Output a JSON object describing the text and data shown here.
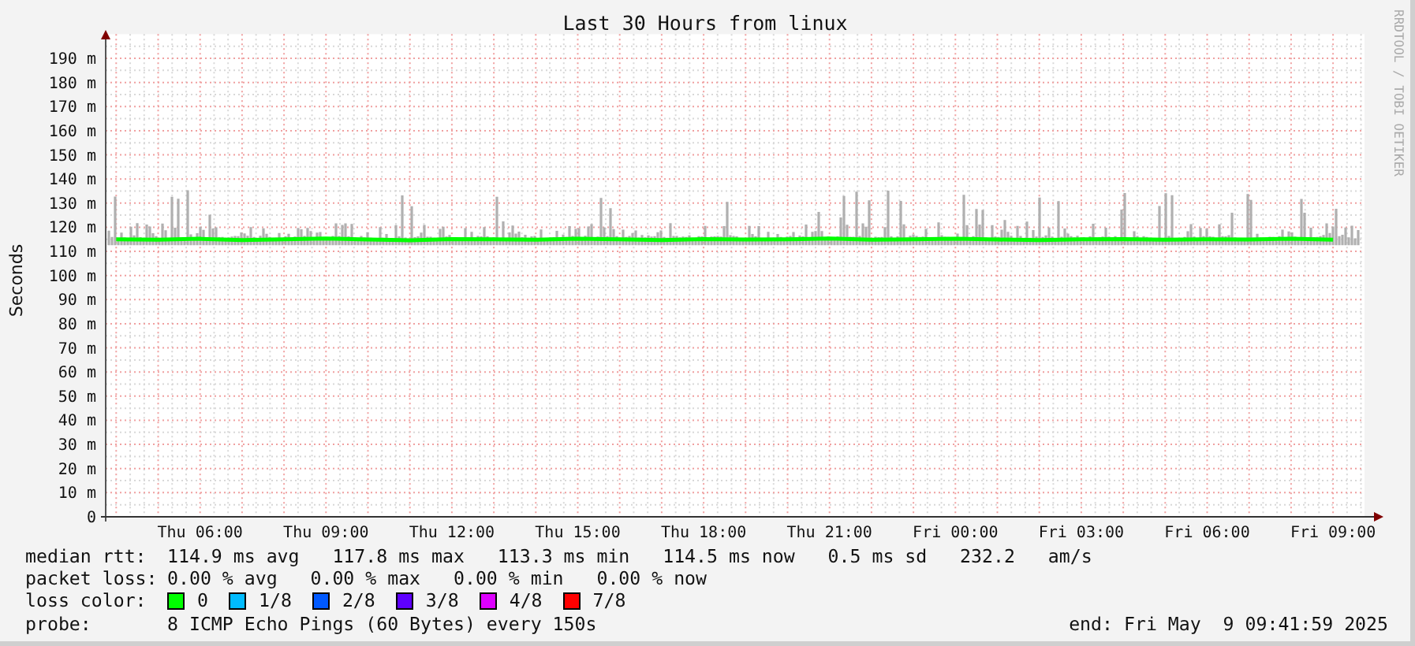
{
  "credit": "RRDTOOL / TOBI OETIKER",
  "chart": {
    "chart_data": {
      "type": "line",
      "title": "Last 30 Hours from linux",
      "ylabel": "Seconds",
      "categories": [
        null,
        null,
        "Thu 06:00",
        null,
        null,
        "Thu 09:00",
        null,
        null,
        "Thu 12:00",
        null,
        null,
        "Thu 15:00",
        null,
        null,
        "Thu 18:00",
        null,
        null,
        "Thu 21:00",
        null,
        null,
        "Fri 00:00",
        null,
        null,
        "Fri 03:00",
        null,
        null,
        "Fri 06:00",
        null,
        null,
        "Fri 09:00"
      ],
      "series": [
        {
          "color": "#00ff00",
          "values": [
            115.0,
            114.8,
            115.2,
            114.7,
            115.0,
            115.3,
            114.9,
            114.6,
            115.1,
            115.0,
            114.8,
            115.2,
            115.0,
            114.7,
            115.1,
            114.9,
            115.0,
            115.3,
            114.8,
            115.0,
            115.2,
            114.9,
            114.7,
            115.0,
            115.1,
            114.8,
            115.0,
            114.9,
            115.2,
            114.8
          ]
        }
      ],
      "ylim": [
        0,
        200
      ],
      "grid": true,
      "yticks": [
        {
          "value": 0,
          "label": "0"
        },
        {
          "value": 10,
          "label": "10 m"
        },
        {
          "value": 20,
          "label": "20 m"
        },
        {
          "value": 30,
          "label": "30 m"
        },
        {
          "value": 40,
          "label": "40 m"
        },
        {
          "value": 50,
          "label": "50 m"
        },
        {
          "value": 60,
          "label": "60 m"
        },
        {
          "value": 70,
          "label": "70 m"
        },
        {
          "value": 80,
          "label": "80 m"
        },
        {
          "value": 90,
          "label": "90 m"
        },
        {
          "value": 100,
          "label": "100 m"
        },
        {
          "value": 110,
          "label": "110 m"
        },
        {
          "value": 120,
          "label": "120 m"
        },
        {
          "value": 130,
          "label": "130 m"
        },
        {
          "value": 140,
          "label": "140 m"
        },
        {
          "value": 150,
          "label": "150 m"
        },
        {
          "value": 160,
          "label": "160 m"
        },
        {
          "value": 170,
          "label": "170 m"
        },
        {
          "value": 180,
          "label": "180 m"
        },
        {
          "value": 190,
          "label": "190 m"
        }
      ]
    }
  },
  "legend": {
    "median_rtt": {
      "label": "median rtt:",
      "text": "114.9 ms avg   117.8 ms max   113.3 ms min   114.5 ms now   0.5 ms sd   232.2   am/s"
    },
    "packet_loss": {
      "label": "packet loss:",
      "text": "0.00 % avg   0.00 % max   0.00 % min   0.00 % now"
    },
    "loss_color": {
      "label": "loss color:",
      "items": [
        {
          "label": "0",
          "color": "#00ff00"
        },
        {
          "label": "1/8",
          "color": "#00bbff"
        },
        {
          "label": "2/8",
          "color": "#0059ff"
        },
        {
          "label": "3/8",
          "color": "#5e00ff"
        },
        {
          "label": "4/8",
          "color": "#dd00ff"
        },
        {
          "label": "7/8",
          "color": "#ff0000"
        }
      ]
    },
    "probe": {
      "label": "probe:",
      "text": "8 ICMP Echo Pings (60 Bytes) every 150s"
    },
    "end": "end: Fri May  9 09:41:59 2025"
  }
}
